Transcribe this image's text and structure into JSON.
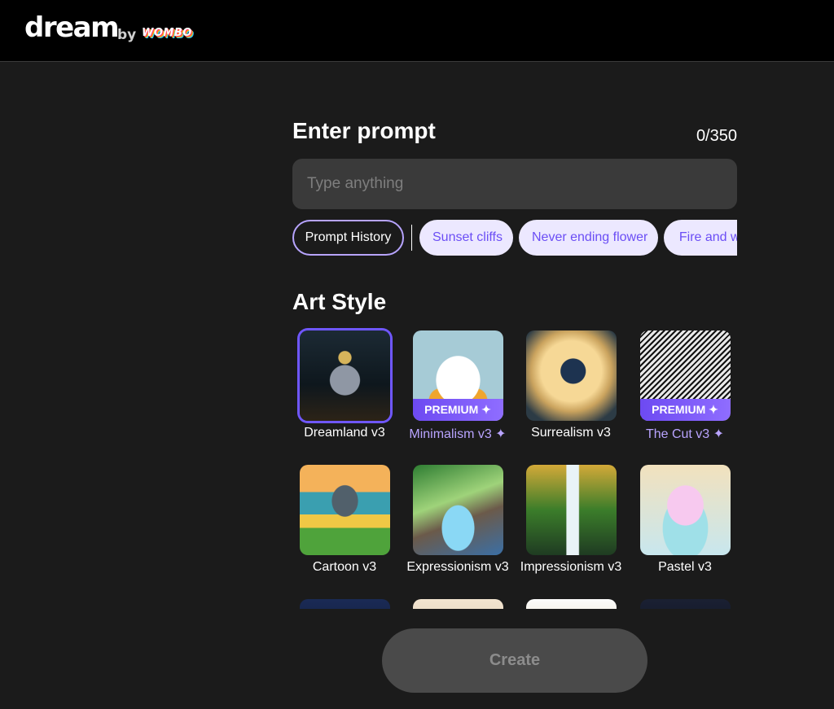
{
  "header": {
    "logo_text": "dream",
    "by_text": "by",
    "brand_text": "WOMBO"
  },
  "prompt": {
    "title": "Enter prompt",
    "counter": "0/350",
    "placeholder": "Type anything",
    "value": ""
  },
  "chips": {
    "history_label": "Prompt History",
    "suggestions": [
      "Sunset cliffs",
      "Never ending flower",
      "Fire and water"
    ]
  },
  "art_style": {
    "title": "Art Style",
    "premium_badge": "PREMIUM ✦",
    "styles": [
      {
        "label": "Dreamland v3",
        "premium": false,
        "selected": true
      },
      {
        "label": "Minimalism v3 ✦",
        "premium": true,
        "selected": false
      },
      {
        "label": "Surrealism v3",
        "premium": false,
        "selected": false
      },
      {
        "label": "The Cut v3 ✦",
        "premium": true,
        "selected": false
      },
      {
        "label": "Cartoon v3",
        "premium": false,
        "selected": false
      },
      {
        "label": "Expressionism v3",
        "premium": false,
        "selected": false
      },
      {
        "label": "Impressionism v3",
        "premium": false,
        "selected": false
      },
      {
        "label": "Pastel v3",
        "premium": false,
        "selected": false
      }
    ]
  },
  "create_button": "Create",
  "colors": {
    "accent": "#6f57ff",
    "premium_text": "#b9a4ff",
    "chip_bg": "#ece8ff",
    "chip_text": "#6b4ef5",
    "background": "#1b1b1b"
  }
}
